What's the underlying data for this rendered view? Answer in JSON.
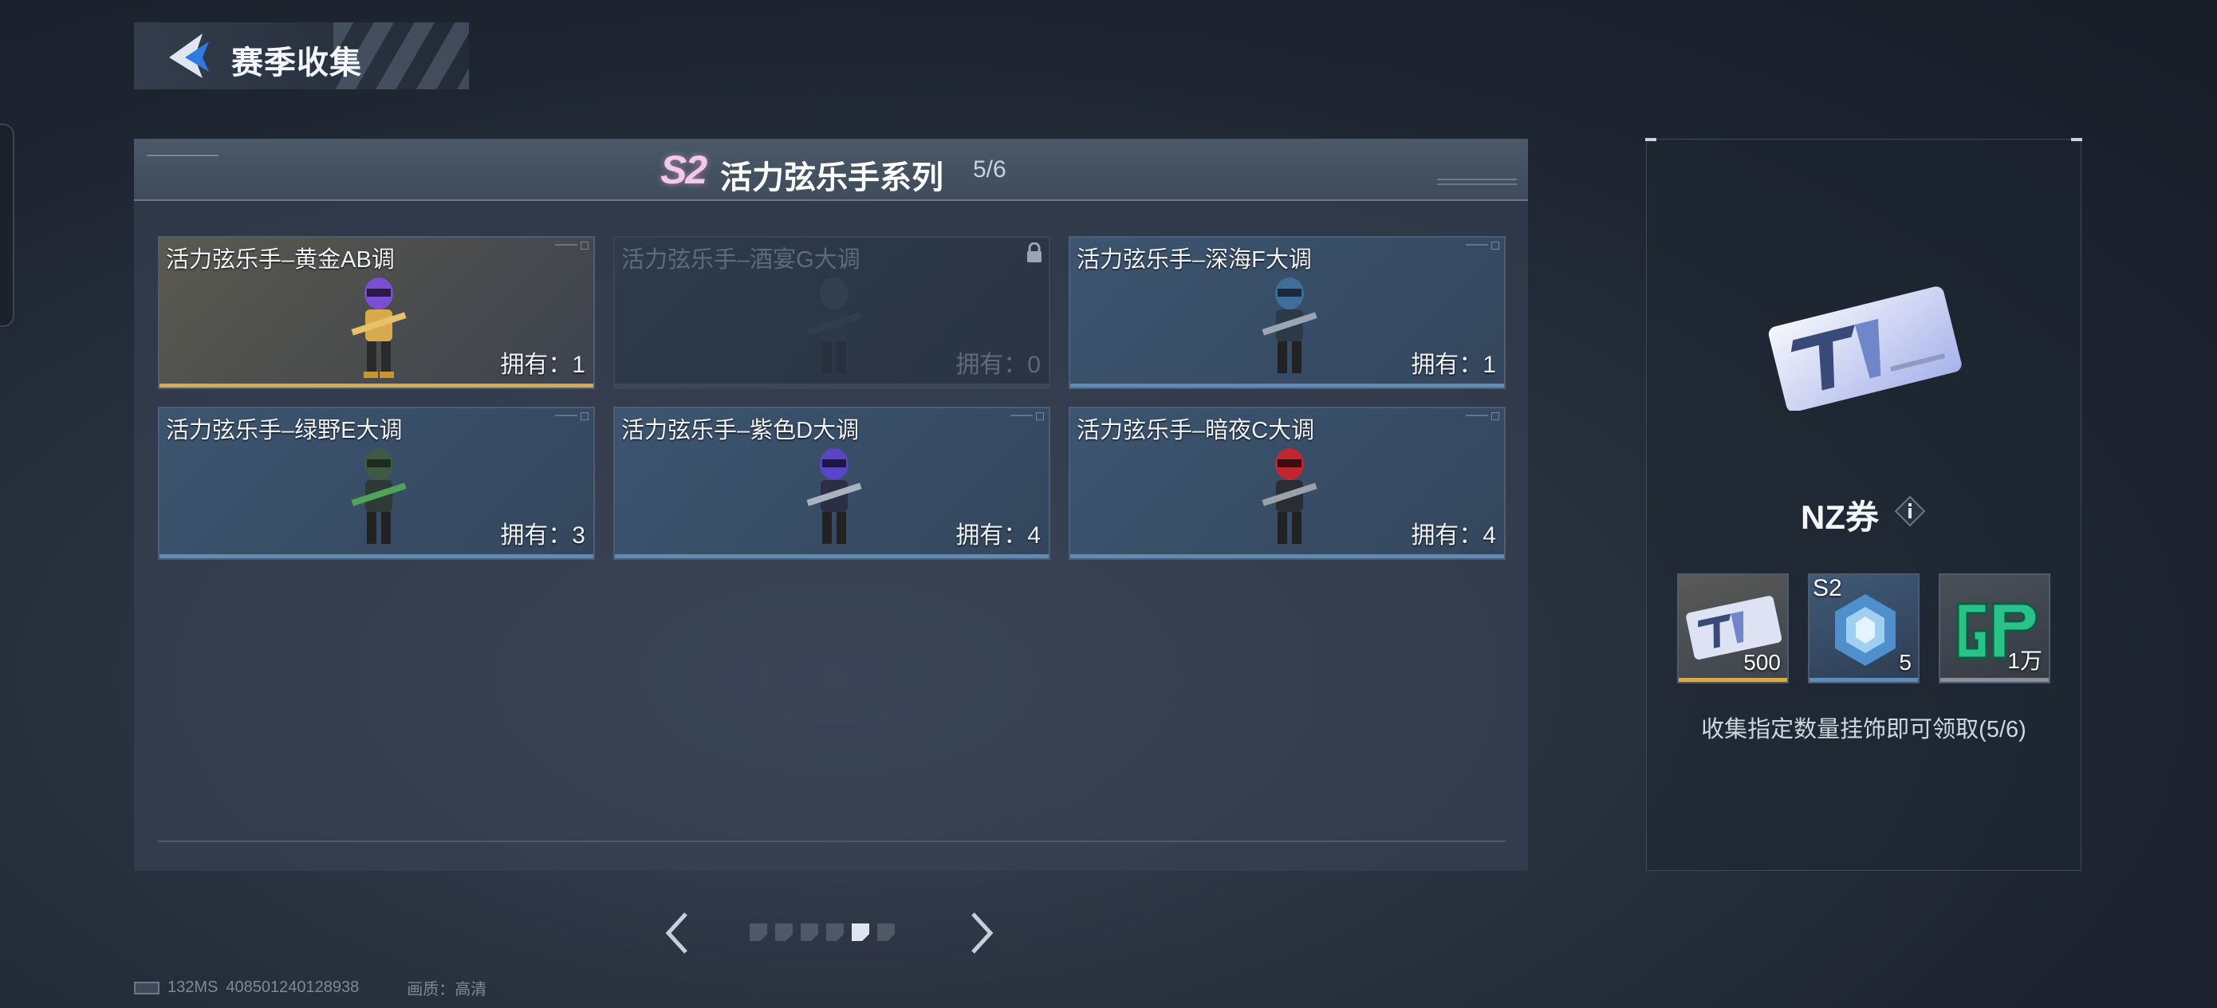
{
  "header": {
    "title": "赛季收集"
  },
  "series": {
    "badge": "S2",
    "title": "活力弦乐手系列",
    "progress": "5/6"
  },
  "cards": [
    {
      "name": "活力弦乐手–黄金AB调",
      "owned": "拥有：1",
      "rarity": "gold",
      "locked": false,
      "accent": "#7b4fd1"
    },
    {
      "name": "活力弦乐手–酒宴G大调",
      "owned": "拥有：0",
      "rarity": "blue",
      "locked": true,
      "accent": "#3b4a5a"
    },
    {
      "name": "活力弦乐手–深海F大调",
      "owned": "拥有：1",
      "rarity": "blue",
      "locked": false,
      "accent": "#3d6f9a"
    },
    {
      "name": "活力弦乐手–绿野E大调",
      "owned": "拥有：3",
      "rarity": "blue",
      "locked": false,
      "accent": "#3f7a44"
    },
    {
      "name": "活力弦乐手–紫色D大调",
      "owned": "拥有：4",
      "rarity": "blue",
      "locked": false,
      "accent": "#5a45c9"
    },
    {
      "name": "活力弦乐手–暗夜C大调",
      "owned": "拥有：4",
      "rarity": "blue",
      "locked": false,
      "accent": "#c0262f"
    }
  ],
  "pagination": {
    "total": 6,
    "active_index": 4
  },
  "reward": {
    "name": "NZ券",
    "items": [
      {
        "qty": "500",
        "tag": "",
        "icon": "nz-ticket-icon"
      },
      {
        "qty": "5",
        "tag": "S2",
        "icon": "crystal-icon"
      },
      {
        "qty": "1万",
        "tag": "",
        "icon": "gp-icon"
      }
    ],
    "description": "收集指定数量挂饰即可领取(5/6)"
  },
  "footer": {
    "ping": "132MS",
    "uid": "408501240128938",
    "quality": "画质：高清"
  },
  "colors": {
    "gold_bar": "#d9a94d",
    "blue_bar": "#5d8cb8",
    "badge": "#f3c9e6"
  }
}
